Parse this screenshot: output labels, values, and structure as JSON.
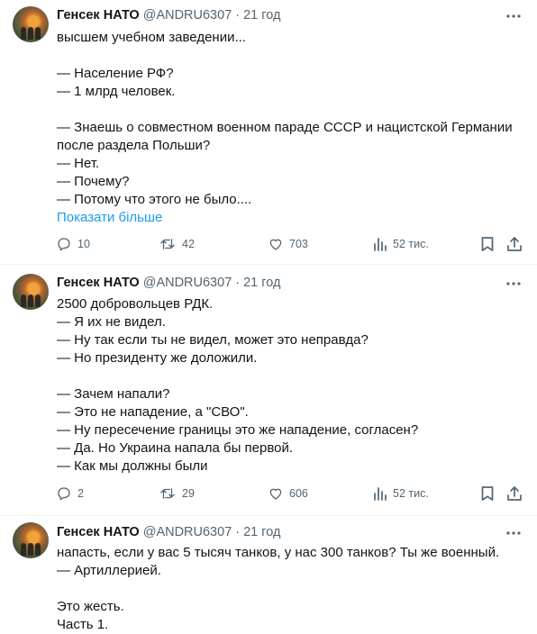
{
  "colors": {
    "text": "#0f1419",
    "muted": "#536471",
    "link": "#1d9bf0"
  },
  "icons": {
    "reply": "reply-icon",
    "repost": "repost-icon",
    "like": "like-icon",
    "views": "views-icon",
    "bookmark": "bookmark-icon",
    "share": "share-icon",
    "more": "more-icon"
  },
  "tweets": [
    {
      "author": {
        "name": "Генсек НАТО",
        "handle": "@ANDRU6307",
        "dot": "·",
        "time": "21 год"
      },
      "lines": [
        "высшем учебном заведении...",
        "",
        "— Население РФ?",
        "— 1 млрд человек.",
        "",
        "— Знаешь о совместном военном параде СССР и нацистской Германии",
        "после раздела Польши?",
        "— Нет.",
        "— Почему?",
        "— Потому что этого не было...."
      ],
      "show_more": "Показати більше",
      "stats": {
        "replies": "10",
        "reposts": "42",
        "likes": "703",
        "views": "52 тис."
      }
    },
    {
      "author": {
        "name": "Генсек НАТО",
        "handle": "@ANDRU6307",
        "dot": "·",
        "time": "21 год"
      },
      "lines": [
        "2500 добровольцев РДК.",
        "— Я их не видел.",
        "— Ну так если ты не видел, может это неправда?",
        "— Но президенту же доложили.",
        "",
        "— Зачем напали?",
        "— Это не нападение, а \"СВО\".",
        "— Ну пересечение границы это же нападение, согласен?",
        "— Да. Но Украина напала бы первой.",
        "— Как мы должны были"
      ],
      "stats": {
        "replies": "2",
        "reposts": "29",
        "likes": "606",
        "views": "52 тис."
      }
    },
    {
      "author": {
        "name": "Генсек НАТО",
        "handle": "@ANDRU6307",
        "dot": "·",
        "time": "21 год"
      },
      "lines": [
        "напасть, если у вас 5 тысяч танков, у нас 300 танков? Ты же военный.",
        "— Артиллерией.",
        "",
        "Это жесть.",
        "Часть 1."
      ]
    }
  ]
}
